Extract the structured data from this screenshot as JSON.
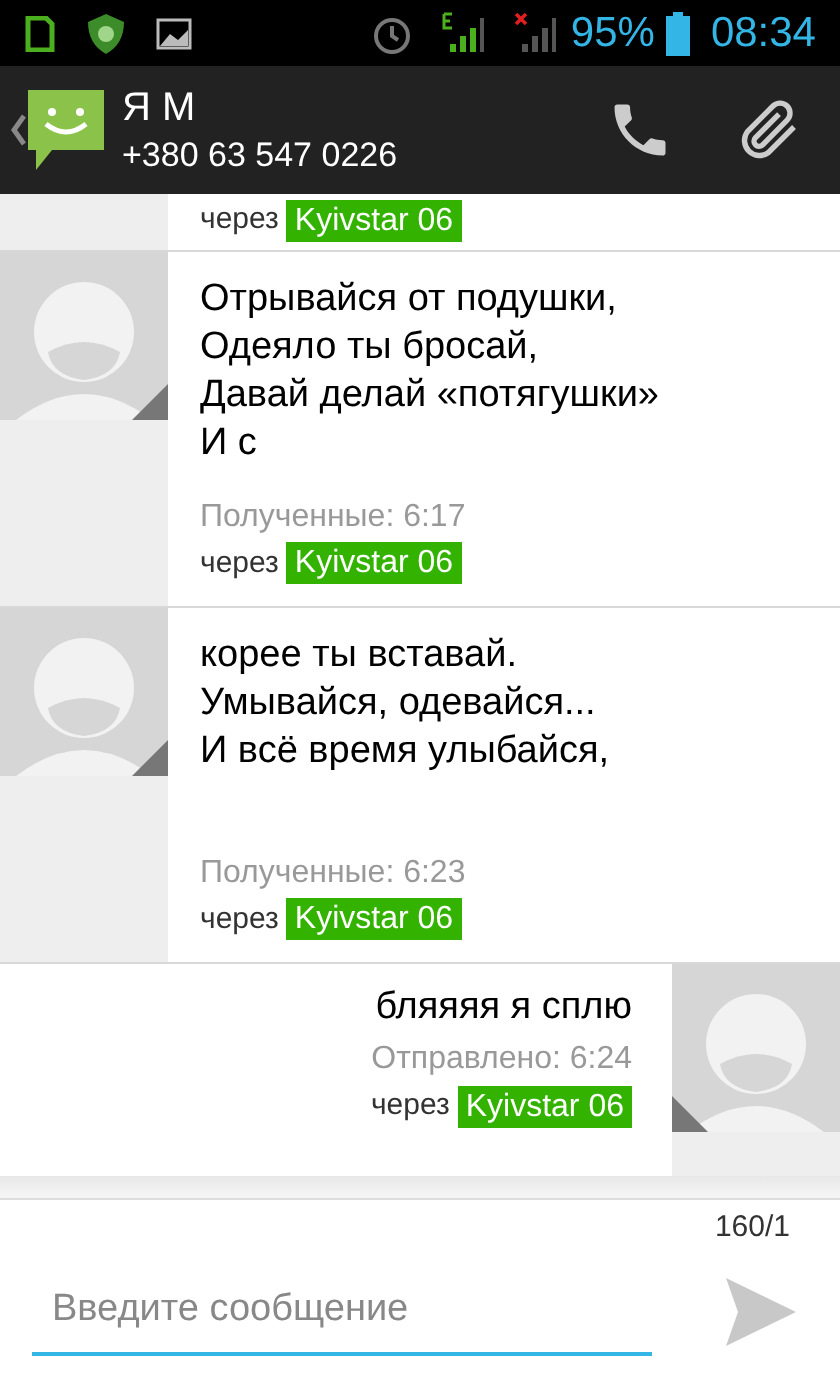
{
  "status_bar": {
    "battery": "95%",
    "time": "08:34"
  },
  "header": {
    "name": "Я М",
    "phone": "+380 63 547 0226"
  },
  "messages": [
    {
      "kind": "partial",
      "via": "через",
      "carrier": "Kyivstar 06"
    },
    {
      "kind": "received",
      "lines": [
        "Отрывайся от подушки,",
        "Одеяло ты бросай,",
        "Давай делай «потягушки»",
        "И с"
      ],
      "status": "Полученные: 6:17",
      "via": "через",
      "carrier": "Kyivstar 06"
    },
    {
      "kind": "received",
      "lines": [
        "корее ты вставай.",
        "Умывайся, одевайся...",
        "И всё время улыбайся,"
      ],
      "status": "Полученные: 6:23",
      "via": "через",
      "carrier": "Kyivstar 06"
    },
    {
      "kind": "sent",
      "lines": [
        "бляяяя я сплю"
      ],
      "status": "Отправлено: 6:24",
      "via": "через",
      "carrier": "Kyivstar 06"
    }
  ],
  "composer": {
    "counter": "160/1",
    "placeholder": "Введите сообщение"
  }
}
